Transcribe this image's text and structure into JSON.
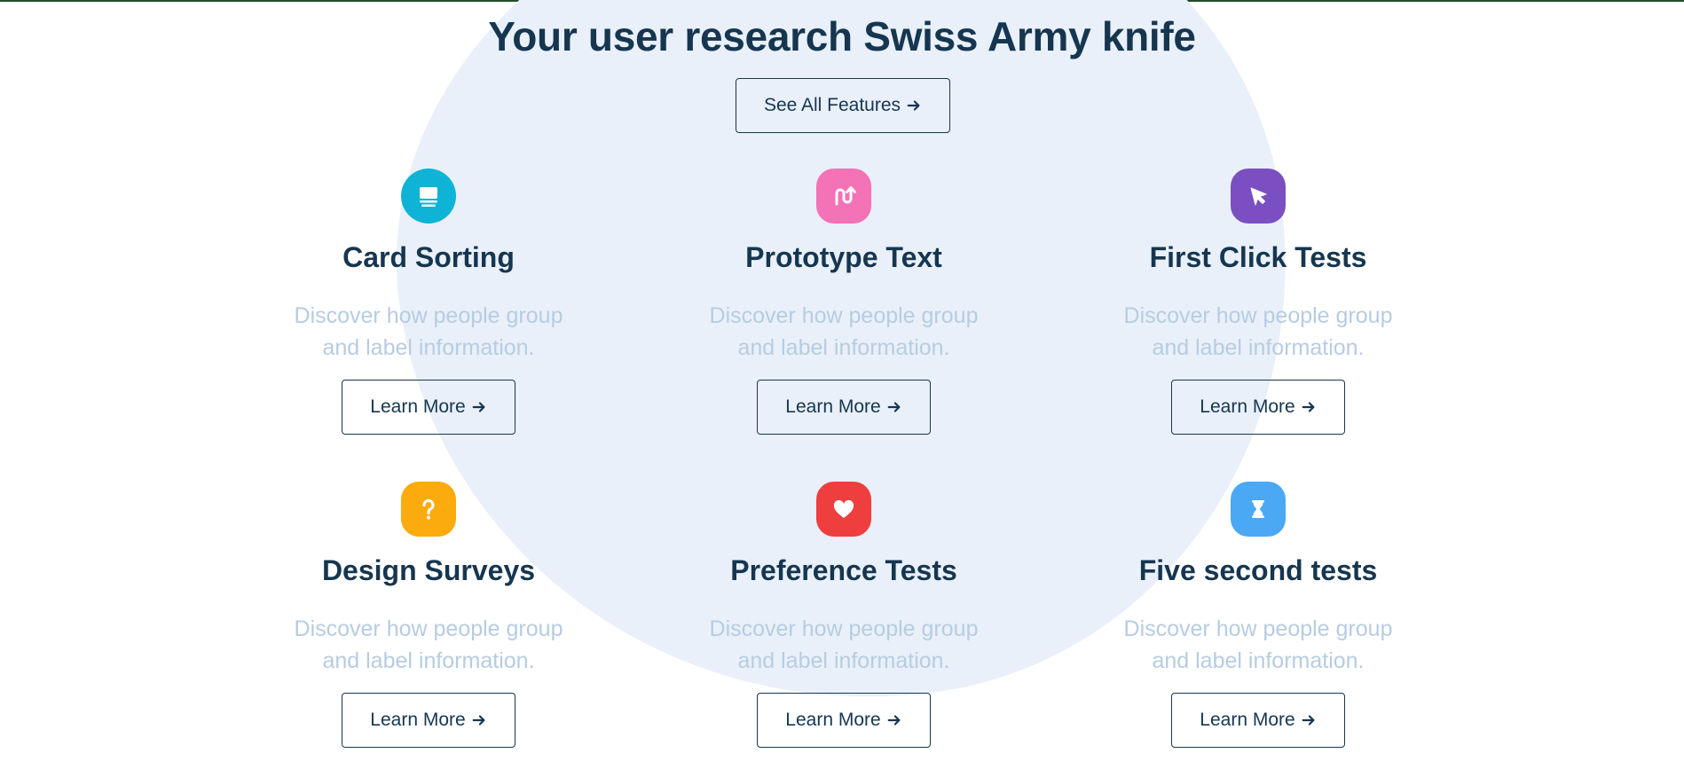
{
  "headline": "Your user research Swiss Army knife",
  "see_all_button": {
    "label": "See All Features",
    "icon": "arrow-right-icon"
  },
  "colors": {
    "heading": "#163650",
    "description": "#b7cce2",
    "blob": "#e9f0f9",
    "top_rule": "#1f4d2a"
  },
  "features": [
    {
      "title": "Card Sorting",
      "description": "Discover how people group and label information.",
      "button_label": "Learn More",
      "icon": "card-stack-icon",
      "icon_color": "#0eb3d6"
    },
    {
      "title": "Prototype Text",
      "description": "Discover how people group and label information.",
      "button_label": "Learn More",
      "icon": "path-arrow-icon",
      "icon_color": "#f472b6"
    },
    {
      "title": "First Click Tests",
      "description": "Discover how people group and label information.",
      "button_label": "Learn More",
      "icon": "cursor-icon",
      "icon_color": "#7b4fc1"
    },
    {
      "title": "Design Surveys",
      "description": "Discover how people group and label information.",
      "button_label": "Learn More",
      "icon": "question-icon",
      "icon_color": "#fbab0e"
    },
    {
      "title": "Preference Tests",
      "description": "Discover how people group and label information.",
      "button_label": "Learn More",
      "icon": "heart-icon",
      "icon_color": "#ef3e3e"
    },
    {
      "title": "Five second tests",
      "description": "Discover how people group and label information.",
      "button_label": "Learn More",
      "icon": "hourglass-icon",
      "icon_color": "#4aa8f5"
    }
  ]
}
